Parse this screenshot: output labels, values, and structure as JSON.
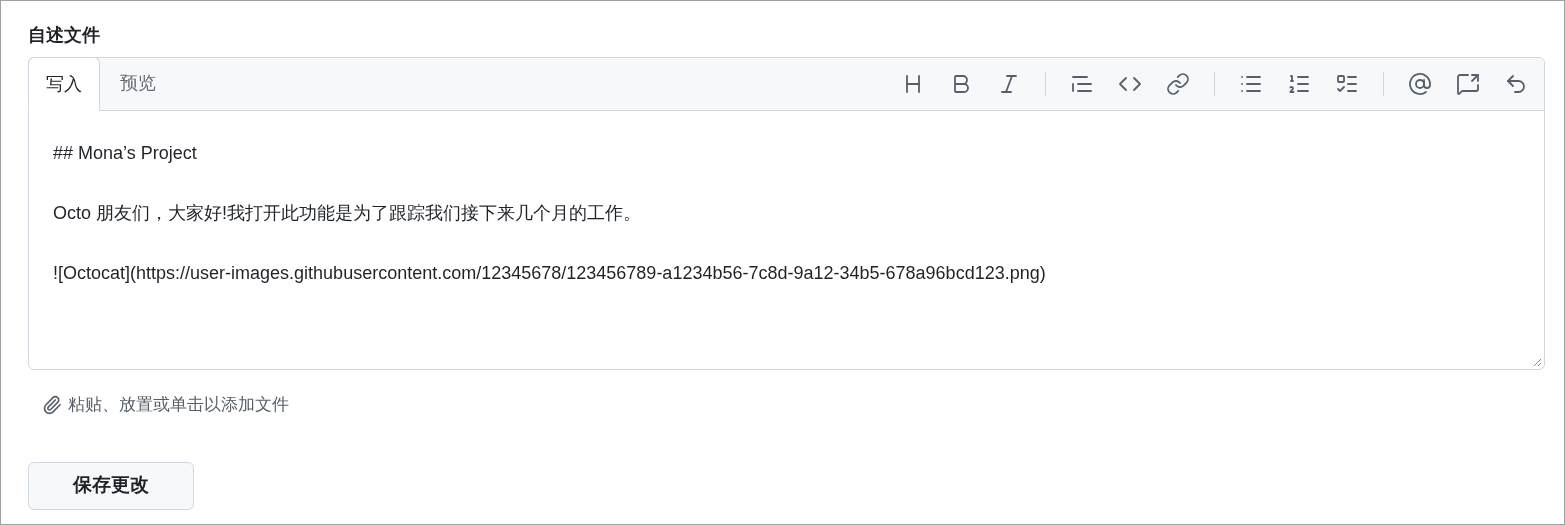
{
  "field_label": "自述文件",
  "tabs": [
    {
      "label": "写入",
      "selected": true
    },
    {
      "label": "预览",
      "selected": false
    }
  ],
  "editor": {
    "paragraphs": [
      "## Mona’s Project",
      "Octo 朋友们，大家好!我打开此功能是为了跟踪我们接下来几个月的工作。",
      "![Octocat](https://user-images.githubusercontent.com/12345678/123456789-a1234b56-7c8d-9a12-34b5-678a96bcd123.png)"
    ]
  },
  "attach_hint": "粘贴、放置或单击以添加文件",
  "save_button": "保存更改"
}
